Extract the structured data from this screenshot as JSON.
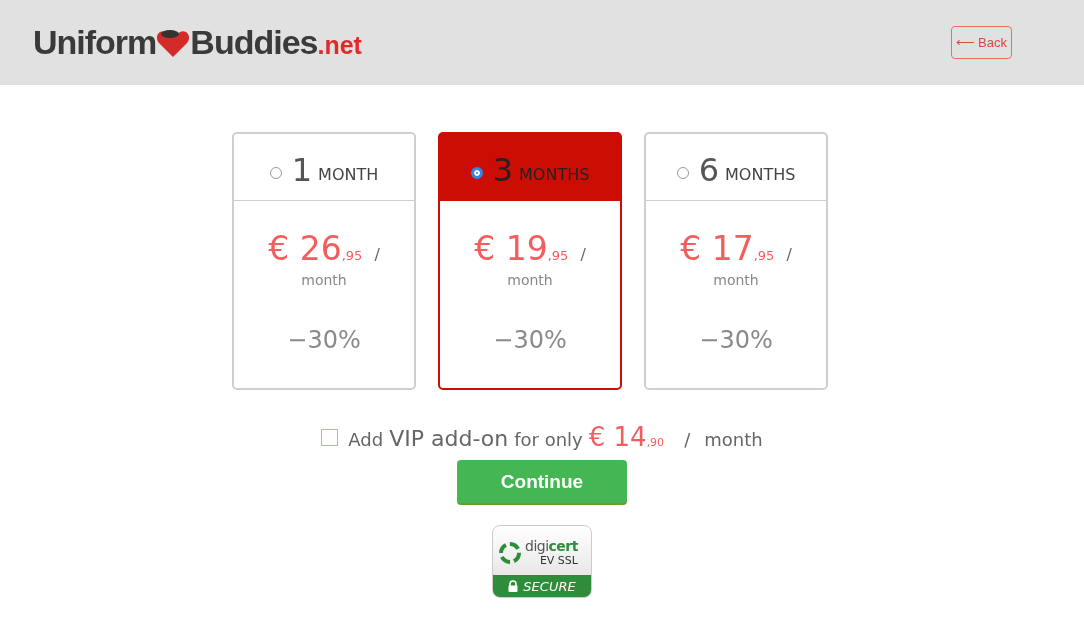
{
  "header": {
    "logo": {
      "left": "Uniform",
      "right": "Buddies",
      "suffix": ".net"
    },
    "back_button": {
      "arrow": "⟵",
      "label": "Back"
    }
  },
  "plans": [
    {
      "count": "1",
      "unit": "MONTH",
      "price": "€ 26",
      "cents": ",95",
      "slash": "/",
      "per": "month",
      "discount": "−30%",
      "selected": false
    },
    {
      "count": "3",
      "unit": "MONTHS",
      "price": "€ 19",
      "cents": ",95",
      "slash": "/",
      "per": "month",
      "discount": "−30%",
      "selected": true
    },
    {
      "count": "6",
      "unit": "MONTHS",
      "price": "€ 17",
      "cents": ",95",
      "slash": "/",
      "per": "month",
      "discount": "−30%",
      "selected": false
    }
  ],
  "addon": {
    "checked": false,
    "add": "Add",
    "name": "VIP add-on",
    "for_only": "for only",
    "price": "€ 14",
    "cents": ",90",
    "slash": "/",
    "per": "month"
  },
  "continue_button": "Continue",
  "badge": {
    "brand_a": "digi",
    "brand_b": "cert",
    "line": "EV SSL",
    "secure": "SECURE"
  }
}
